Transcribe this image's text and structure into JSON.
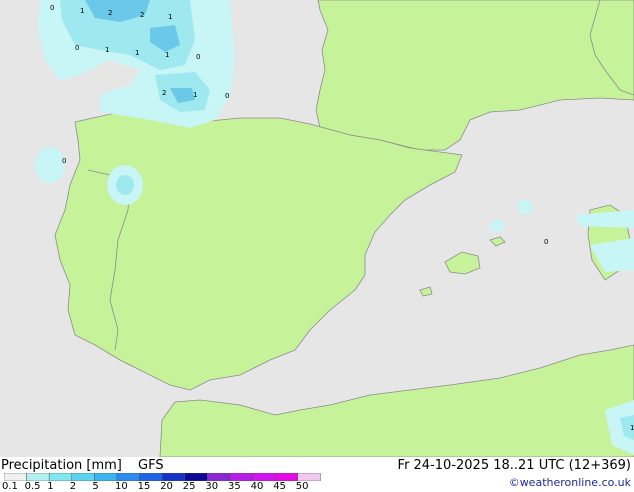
{
  "title": {
    "product": "Precipitation [mm]",
    "model": "GFS",
    "valid_time": "Fr 24-10-2025 18..21 UTC (12+369)"
  },
  "credit": "©weatheronline.co.uk",
  "legend": {
    "values": [
      "0.1",
      "0.5",
      "1",
      "2",
      "5",
      "10",
      "15",
      "20",
      "25",
      "30",
      "35",
      "40",
      "45",
      "50"
    ],
    "colors": [
      "#f0f0f0",
      "#b4f0f0",
      "#82e6f0",
      "#5ad2f0",
      "#3cb4f0",
      "#2d8cf0",
      "#1e64e6",
      "#1432c8",
      "#0a0a96",
      "#8c28d2",
      "#b41ee6",
      "#d214f0",
      "#e60ae6",
      "#f0c8f0"
    ]
  },
  "map": {
    "colors": {
      "sea": "#e6e6e6",
      "land": "#c6f29a",
      "border": "#8c8c8c",
      "rain_light": "#c8f5f5",
      "rain_mid": "#9ee8f0",
      "rain_heavy": "#6cc8e8"
    },
    "precip_labels": [
      "0",
      "1",
      "2",
      "2",
      "1",
      "0",
      "1",
      "1",
      "1",
      "0",
      "2",
      "1",
      "0",
      "0",
      "0",
      "1"
    ]
  }
}
